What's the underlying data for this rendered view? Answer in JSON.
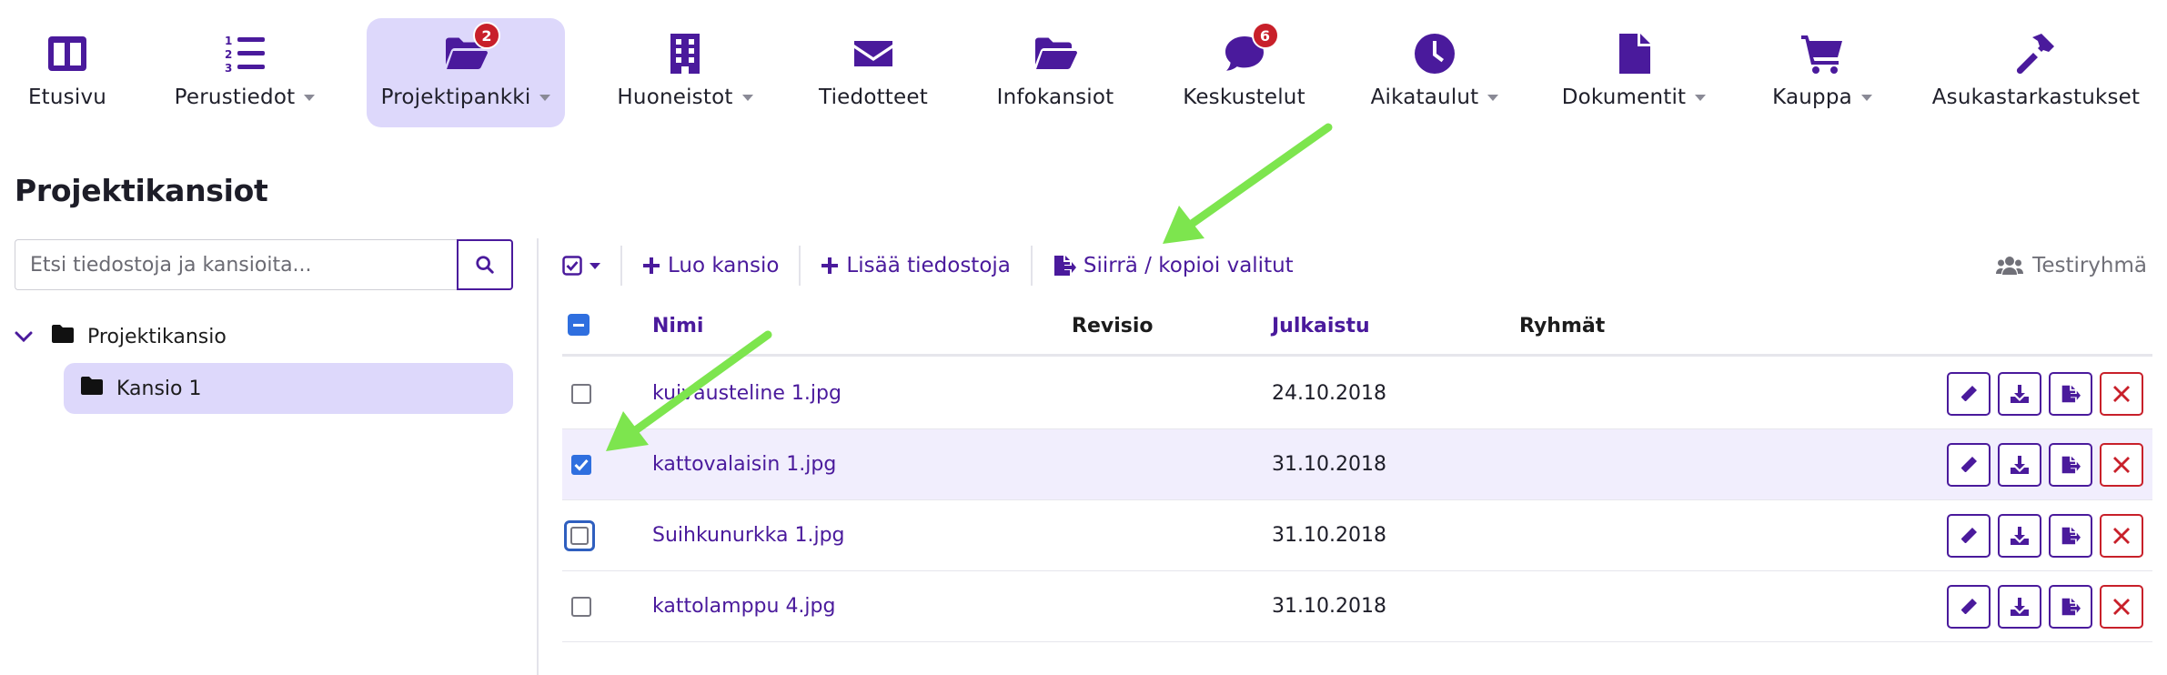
{
  "colors": {
    "accent": "#4a1a9c",
    "active_bg": "#ddd8fb",
    "badge": "#c8202a",
    "checkbox": "#2f6fdf",
    "delete": "#c8202a",
    "annotation_arrow": "#7de54e"
  },
  "nav": {
    "items": [
      {
        "label": "Etusivu",
        "icon": "dashboard-icon",
        "caret": false,
        "badge": ""
      },
      {
        "label": "Perustiedot",
        "icon": "numbered-list-icon",
        "caret": true,
        "badge": ""
      },
      {
        "label": "Projektipankki",
        "icon": "folder-open-icon",
        "caret": true,
        "badge": "2",
        "active": true
      },
      {
        "label": "Huoneistot",
        "icon": "building-icon",
        "caret": true,
        "badge": ""
      },
      {
        "label": "Tiedotteet",
        "icon": "envelope-icon",
        "caret": false,
        "badge": ""
      },
      {
        "label": "Infokansiot",
        "icon": "folder-open-icon",
        "caret": false,
        "badge": ""
      },
      {
        "label": "Keskustelut",
        "icon": "chat-icon",
        "caret": false,
        "badge": "6"
      },
      {
        "label": "Aikataulut",
        "icon": "clock-icon",
        "caret": true,
        "badge": ""
      },
      {
        "label": "Dokumentit",
        "icon": "document-icon",
        "caret": true,
        "badge": ""
      },
      {
        "label": "Kauppa",
        "icon": "cart-icon",
        "caret": true,
        "badge": ""
      },
      {
        "label": "Asukastarkastukset",
        "icon": "hammer-icon",
        "caret": false,
        "badge": ""
      }
    ]
  },
  "page": {
    "title": "Projektikansiot"
  },
  "sidebar": {
    "search_placeholder": "Etsi tiedostoja ja kansioita...",
    "tree_root": "Projektikansio",
    "tree_child": "Kansio 1"
  },
  "toolbar": {
    "create_folder": "Luo kansio",
    "add_files": "Lisää tiedostoja",
    "move_copy": "Siirrä / kopioi valitut",
    "group": "Testiryhmä"
  },
  "table": {
    "headers": {
      "name": "Nimi",
      "revision": "Revisio",
      "published": "Julkaistu",
      "groups": "Ryhmät"
    },
    "rows": [
      {
        "name": "kuivausteline 1.jpg",
        "date": "24.10.2018",
        "checked": false
      },
      {
        "name": "kattovalaisin 1.jpg",
        "date": "31.10.2018",
        "checked": true
      },
      {
        "name": "Suihkunurkka 1.jpg",
        "date": "31.10.2018",
        "checked": false,
        "focused": true
      },
      {
        "name": "kattolamppu 4.jpg",
        "date": "31.10.2018",
        "checked": false
      }
    ]
  }
}
